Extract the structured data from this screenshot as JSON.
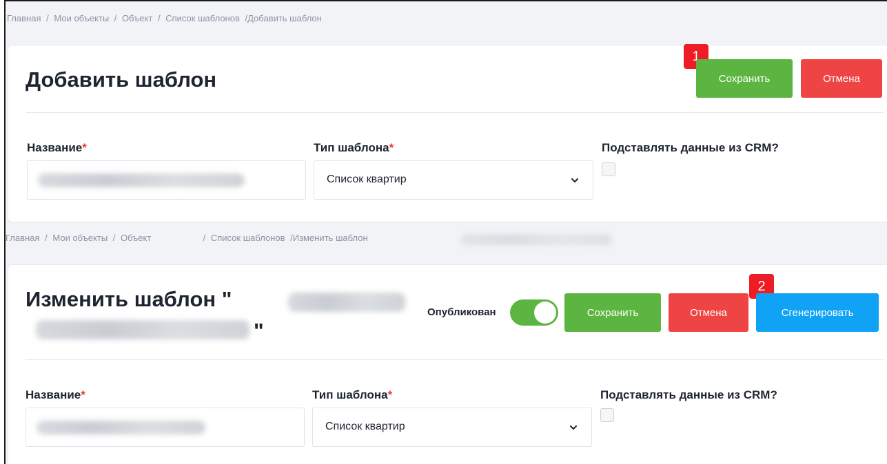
{
  "section_add": {
    "breadcrumb": [
      "Главная",
      "/",
      "Мои объекты",
      "/",
      "Объект",
      "/",
      "Список шаблонов",
      "/Добавить шаблон"
    ],
    "title": "Добавить шаблон",
    "save_label": "Сохранить",
    "cancel_label": "Отмена",
    "badge": "1",
    "name_label": "Название",
    "type_label": "Тип шаблона",
    "type_value": "Список квартир",
    "crm_label": "Подставлять данные из CRM?"
  },
  "section_edit": {
    "breadcrumb": [
      "Главная",
      "/",
      "Мои объекты",
      "/",
      "Объект",
      "/",
      "Список шаблонов",
      "/Изменить шаблон"
    ],
    "title_prefix": "Изменить шаблон \"",
    "title_suffix": "\"",
    "published_label": "Опубликован",
    "save_label": "Сохранить",
    "cancel_label": "Отмена",
    "generate_label": "Сгенерировать",
    "badge": "2",
    "name_label": "Название",
    "type_label": "Тип шаблона",
    "type_value": "Список квартир",
    "crm_label": "Подставлять данные из CRM?"
  },
  "required_mark": "*",
  "colors": {
    "save": "#5bb540",
    "cancel": "#ef4444",
    "generate": "#10a3f5",
    "badge": "#ee1c25"
  }
}
